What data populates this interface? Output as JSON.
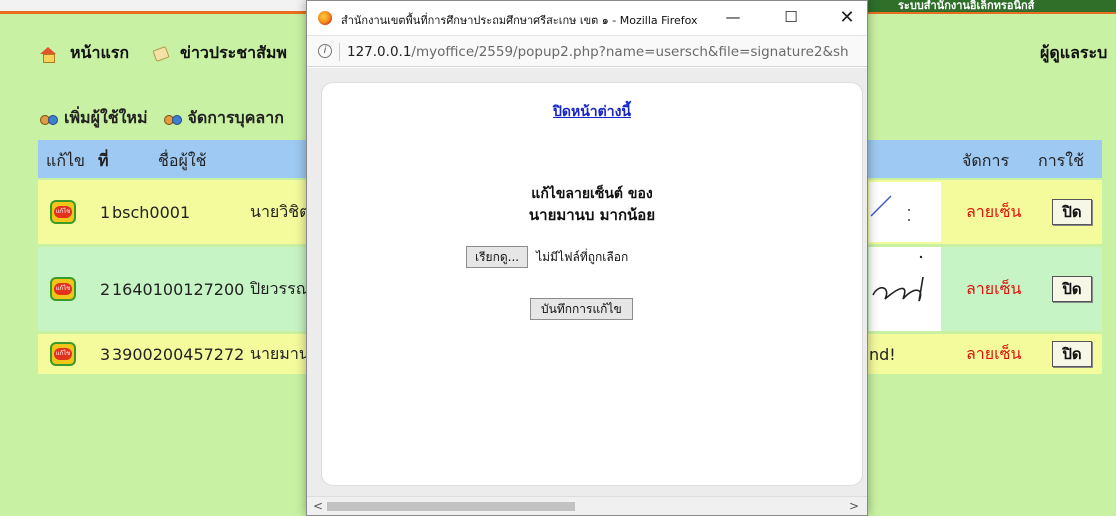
{
  "banner": {
    "right_text": "ระบบสำนักงานอิเล็กทรอนิกส์"
  },
  "nav": {
    "home_label": "หน้าแรก",
    "news_label": "ข่าวประชาสัมพ",
    "right_label": "ผู้ดูแลระบ"
  },
  "actions": {
    "add_user_label": "เพิ่มผู้ใช้ใหม่",
    "manage_label": "จัดการบุคลาก"
  },
  "table": {
    "headers": {
      "edit": "แก้ไข",
      "no": "ที่",
      "username": "ชื่อผู้ใช้",
      "manage": "จัดการ",
      "usage": "การใช้"
    },
    "rows": [
      {
        "no": "1",
        "username": "bsch0001",
        "name": "นายวิชิต",
        "signature_text": "",
        "manage": "ลายเซ็น",
        "usage": "ปิด"
      },
      {
        "no": "2",
        "username": "1640100127200",
        "name": "ปิยวรรณ",
        "signature_text": "",
        "manage": "ลายเซ็น",
        "usage": "ปิด"
      },
      {
        "no": "3",
        "username": "3900200457272",
        "name": "นายมาน",
        "signature_text": "nd!",
        "manage": "ลายเซ็น",
        "usage": "ปิด"
      }
    ],
    "edit_icon_text": "แก้ไข"
  },
  "popup": {
    "window_title": "สำนักงานเขตพื้นที่การศึกษาประถมศึกษาศรีสะเกษ เขต ๑ - Mozilla Firefox",
    "controls": {
      "minimize": "—",
      "maximize": "☐",
      "close": "✕"
    },
    "url_host": "127.0.0.1",
    "url_path": "/myoffice/2559/popup2.php?name=usersch&file=signature2&sh",
    "close_window_link": "ปิดหน้าต่างนี้",
    "heading_line1": "แก้ไขลายเซ็นต์ ของ",
    "heading_line2": "นายมานบ มากน้อย",
    "browse_button": "เรียกดู...",
    "file_status": "ไม่มีไฟล์ที่ถูกเลือก",
    "save_button": "บันทึกการแก้ไข"
  },
  "colors": {
    "page_bg": "#c9f1a3",
    "header_row": "#9ec9f2",
    "row_yellow": "#f3fb9d",
    "row_green": "#c6f4c4",
    "signature_link": "#e0130c",
    "link_blue": "#1525c9"
  }
}
